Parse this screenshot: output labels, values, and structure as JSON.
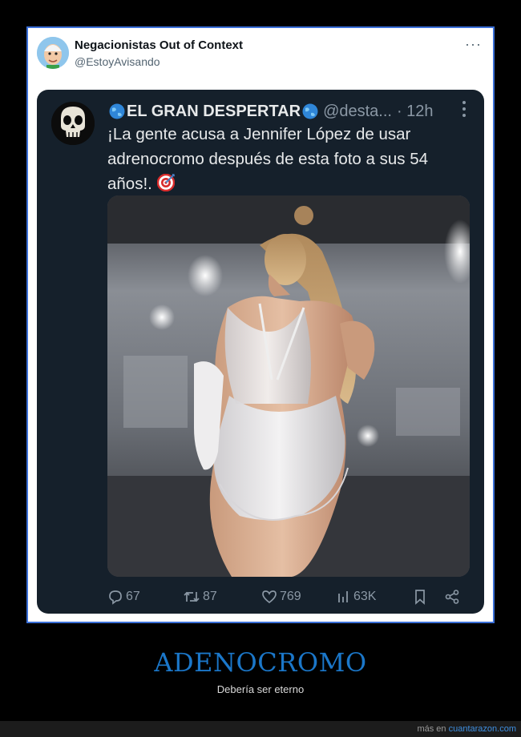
{
  "tweet": {
    "author_name": "Negacionistas Out of Context",
    "author_handle": "@EstoyAvisando",
    "more": "···"
  },
  "quoted": {
    "author_name": "EL GRAN DESPERTAR",
    "author_handle": "@desta...",
    "time": "· 12h",
    "text": "¡La gente acusa a Jennifer López de usar adrenocromo después de esta foto a sus 54 años!.",
    "metrics": {
      "replies": "67",
      "retweets": "87",
      "likes": "769",
      "views": "63K"
    }
  },
  "meme": {
    "title": "ADENOCROMO",
    "subtitle": "Debería ser eterno"
  },
  "footer": {
    "prefix": "más en",
    "site": "cuantarazon.com"
  },
  "colors": {
    "background": "#000000",
    "card": "#15202b",
    "frame_border": "#3a6fd8",
    "title": "#1b77c9"
  }
}
